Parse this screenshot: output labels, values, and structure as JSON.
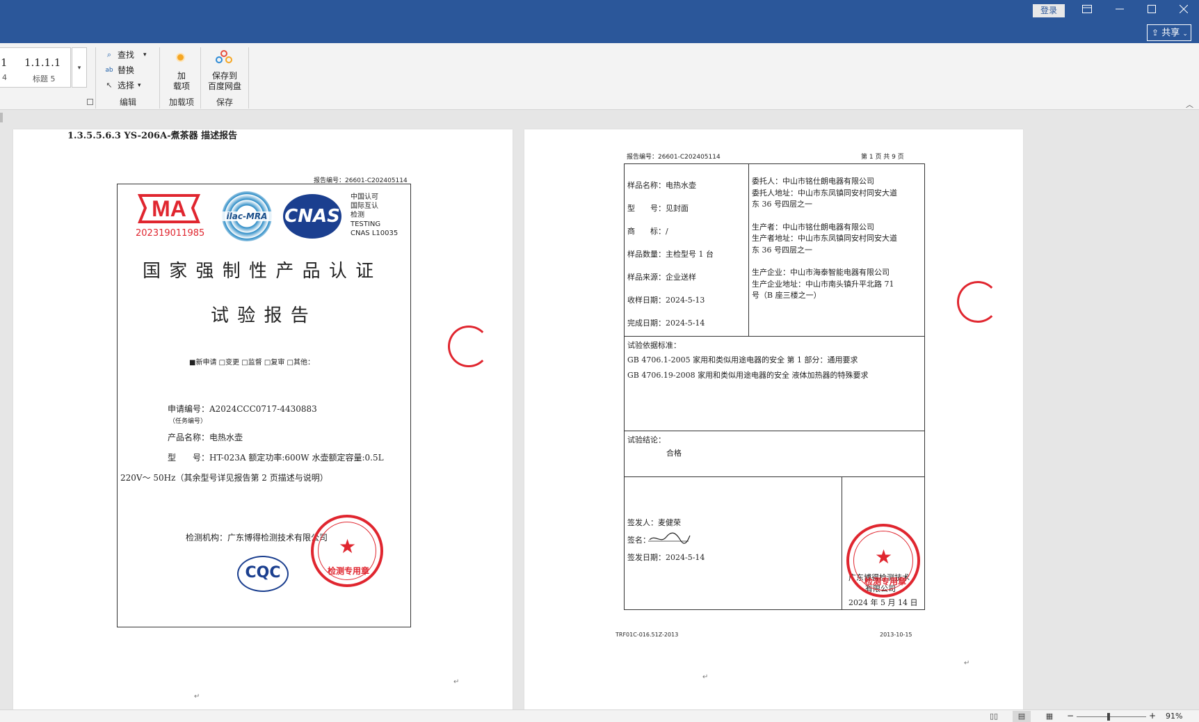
{
  "titlebar": {
    "login": "登录",
    "share": "共享",
    "ribbon_display_icon": "ribbon-display-icon",
    "min_icon": "minimize-icon",
    "max_icon": "maximize-icon",
    "close_icon": "close-icon"
  },
  "ribbon": {
    "styles": [
      {
        "label": "1",
        "sub": "4"
      },
      {
        "label": "1.1.1.1",
        "sub": "标题 5"
      }
    ],
    "editing": {
      "find": "查找",
      "replace": "替换",
      "select": "选择",
      "group": "编辑"
    },
    "addins": {
      "button_line1": "加",
      "button_line2": "载项",
      "group": "加载项"
    },
    "save": {
      "button_line1": "保存到",
      "button_line2": "百度网盘",
      "group": "保存"
    }
  },
  "page1": {
    "heading": "1.3.5.5.6.3   YS-206A-煮茶器 描述报告",
    "report_no": "报告编号：26601-C202405114",
    "ma_number": "202319011985",
    "ilac": "ilac-MRA",
    "cnas": "CNAS",
    "cnas_text": [
      "中国认可",
      "国际互认",
      "检测",
      "TESTING",
      "CNAS L10035"
    ],
    "title1": "国 家 强 制 性 产 品 认 证",
    "title2": "试 验 报 告",
    "checkboxes": "■新申请  □变更  □监督  □复审  □其他：",
    "app_no": "申请编号：A2024CCC0717-4430883",
    "app_no_sub": "（任务编号）",
    "product": "产品名称：电热水壶",
    "model": "型　　号：HT-023A  额定功率:600W  水壶额定容量:0.5L",
    "model2": "220V～ 50Hz（其余型号详见报告第 2 页描述与说明）",
    "lab": "检测机构：广东博得检测技术有限公司",
    "stamp_label": "检测专用章",
    "cqc": "CQC"
  },
  "page2": {
    "report_no": "报告编号：26601-C202405114",
    "page_no": "第 1 页 共 9 页",
    "left": [
      "样品名称：电热水壶",
      "型　　号：见封面",
      "商　　标：/",
      "样品数量：主检型号 1 台",
      "样品来源：企业送样",
      "收样日期：2024-5-13",
      "完成日期：2024-5-14"
    ],
    "right": [
      "委托人：中山市铭仕朗电器有限公司",
      "委托人地址：中山市东凤镇同安村同安大道",
      "东 36 号四层之一",
      "生产者：中山市铭仕朗电器有限公司",
      "生产者地址：中山市东凤镇同安村同安大道",
      "东 36 号四层之一",
      "生产企业：中山市海泰智能电器有限公司",
      "生产企业地址：中山市南头镇升平北路 71",
      "号（B 座三楼之一）"
    ],
    "basis_label": "试验依据标准：",
    "basis": [
      "GB 4706.1-2005   家用和类似用途电器的安全  第 1 部分：通用要求",
      "GB 4706.19-2008  家用和类似用途电器的安全  液体加热器的特殊要求"
    ],
    "conclusion_label": "试验结论：",
    "conclusion": "合格",
    "issuer": "签发人：麦健荣",
    "sign": "签名：",
    "issue_date": "签发日期：2024-5-14",
    "org_line1": "广东博得检测技术",
    "org_line2": "有限公司",
    "org_date": "2024 年 5 月 14 日",
    "stamp_label": "检测专用章",
    "footer_left": "TRF01C-016.51Z-2013",
    "footer_right": "2013-10-15"
  },
  "statusbar": {
    "zoom": "91%",
    "zoom_minus": "−",
    "zoom_plus": "+"
  },
  "zoom_level": 0.91,
  "colors": {
    "title_blue": "#2b579a",
    "stamp_red": "#e0262f",
    "logo_blue": "#1b3f8f"
  }
}
